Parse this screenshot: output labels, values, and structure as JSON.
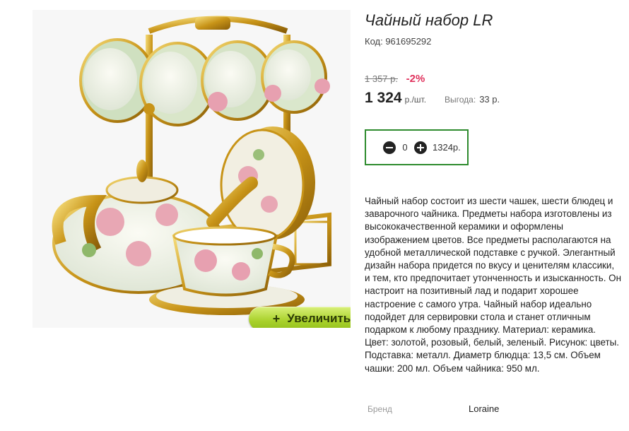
{
  "product": {
    "title": "Чайный набор LR",
    "code": "Код: 961695292",
    "old_price": "1 357 р.",
    "discount": "-2%",
    "price": "1 324",
    "price_unit": "р./шт.",
    "savings_label": "Выгода:",
    "savings_value": "33 р.",
    "image_alt": "Чайный набор LR"
  },
  "quantity": {
    "minus_icon": "minus-circle-icon",
    "plus_icon": "plus-circle-icon",
    "value": "0",
    "total": "1324р."
  },
  "zoom": {
    "icon": "+",
    "label": "Увеличить"
  },
  "description": "Чайный набор состоит из шести чашек, шести блюдец и заварочного чайника. Предметы набора изготовлены из высококачественной керамики и оформлены изображением цветов. Все предметы располагаются на удобной металлической подставке с ручкой. Элегантный дизайн набора придется по вкусу и ценителям классики, и тем, кто предпочитает утонченность и изысканность. Он настроит на позитивный лад и подарит хорошее настроение с самого утра. Чайный набор идеально подойдет для сервировки стола и станет отличным подарком к любому празднику. Материал: керамика. Цвет: золотой, розовый, белый, зеленый. Рисунок: цветы. Подставка: металл. Диаметр блюдца: 13,5 см. Объем чашки: 200 мл. Объем чайника: 950 мл.",
  "brand": {
    "label": "Бренд",
    "value": "Loraine"
  },
  "colors": {
    "accent_green": "#2e8b2e",
    "discount_red": "#e0315c",
    "zoom_button": "#a8d12a"
  }
}
